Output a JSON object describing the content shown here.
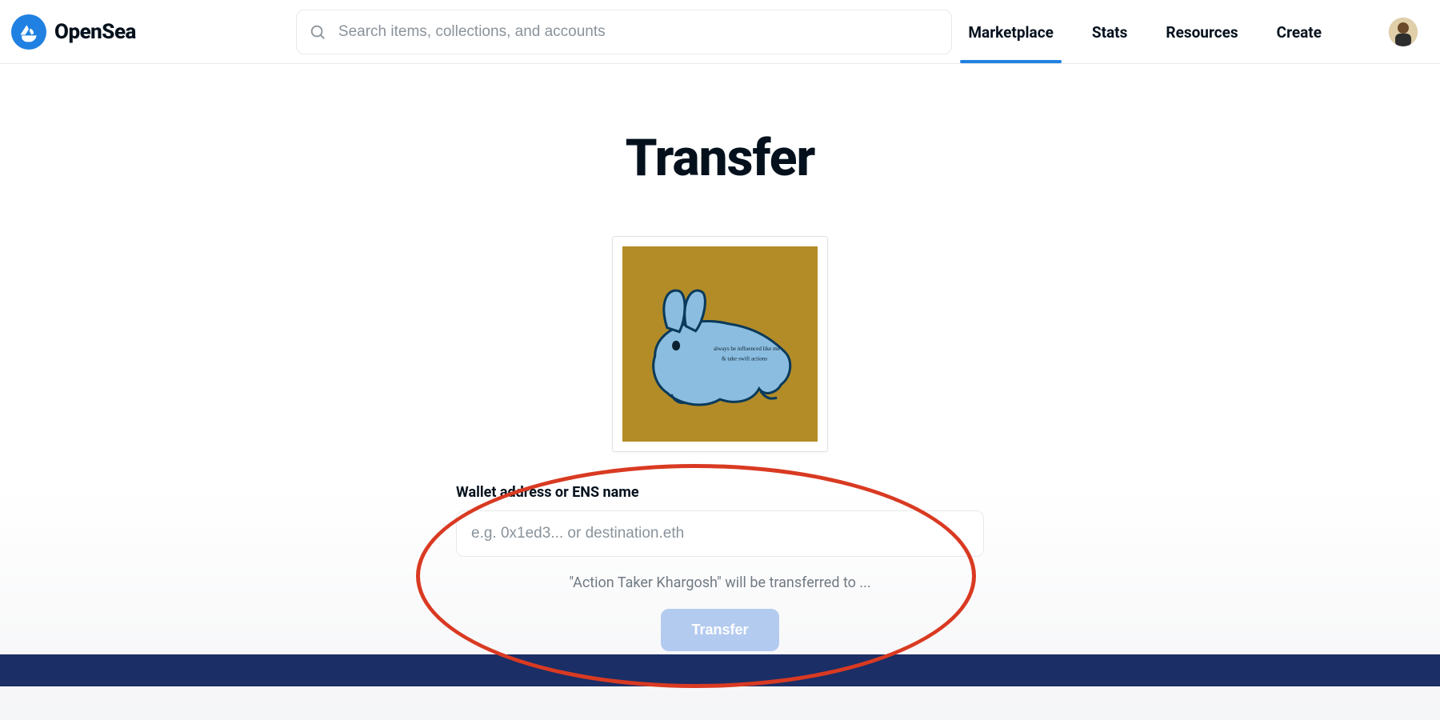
{
  "brand": {
    "name": "OpenSea"
  },
  "search": {
    "placeholder": "Search items, collections, and accounts",
    "value": ""
  },
  "nav": {
    "items": [
      {
        "label": "Marketplace",
        "active": true
      },
      {
        "label": "Stats",
        "active": false
      },
      {
        "label": "Resources",
        "active": false
      },
      {
        "label": "Create",
        "active": false
      }
    ]
  },
  "page": {
    "title": "Transfer",
    "nft_name": "Action Taker Khargosh"
  },
  "form": {
    "address_label": "Wallet address or ENS name",
    "address_placeholder": "e.g. 0x1ed3... or destination.eth",
    "address_value": "",
    "status_text": "\"Action Taker Khargosh\" will be transferred to ...",
    "transfer_button": "Transfer"
  },
  "colors": {
    "accent": "#2081e2",
    "annotation": "#d93a22",
    "footer": "#1b2e66"
  }
}
